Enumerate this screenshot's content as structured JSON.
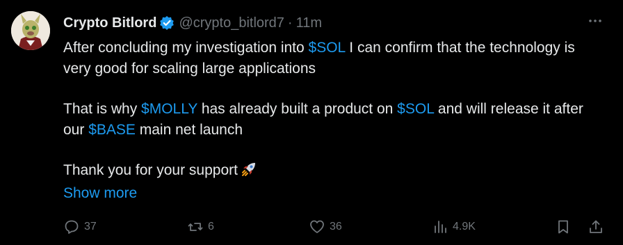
{
  "author": {
    "name": "Crypto Bitlord",
    "handle": "@crypto_bitlord7",
    "separator": "·",
    "time": "11m"
  },
  "body": {
    "p1_a": "After concluding my investigation into ",
    "p1_cash": "$SOL",
    "p1_b": " I can confirm that the technology is very good for scaling large applications",
    "p2_a": "That is why ",
    "p2_cash1": "$MOLLY",
    "p2_b": " has already built a product on ",
    "p2_cash2": "$SOL",
    "p2_c": " and will release it after our ",
    "p2_cash3": "$BASE",
    "p2_d": " main net launch",
    "p3": "Thank you for your support"
  },
  "show_more": "Show more",
  "actions": {
    "replies": "37",
    "reposts": "6",
    "likes": "36",
    "views": "4.9K"
  },
  "colors": {
    "background": "#000000",
    "text": "#e7e9ea",
    "muted": "#71767b",
    "accent": "#1d9bf0"
  },
  "icons": [
    "verified-badge-icon",
    "more-options-icon",
    "rocket-emoji-icon",
    "reply-icon",
    "repost-icon",
    "like-icon",
    "views-icon",
    "bookmark-icon",
    "share-icon"
  ]
}
